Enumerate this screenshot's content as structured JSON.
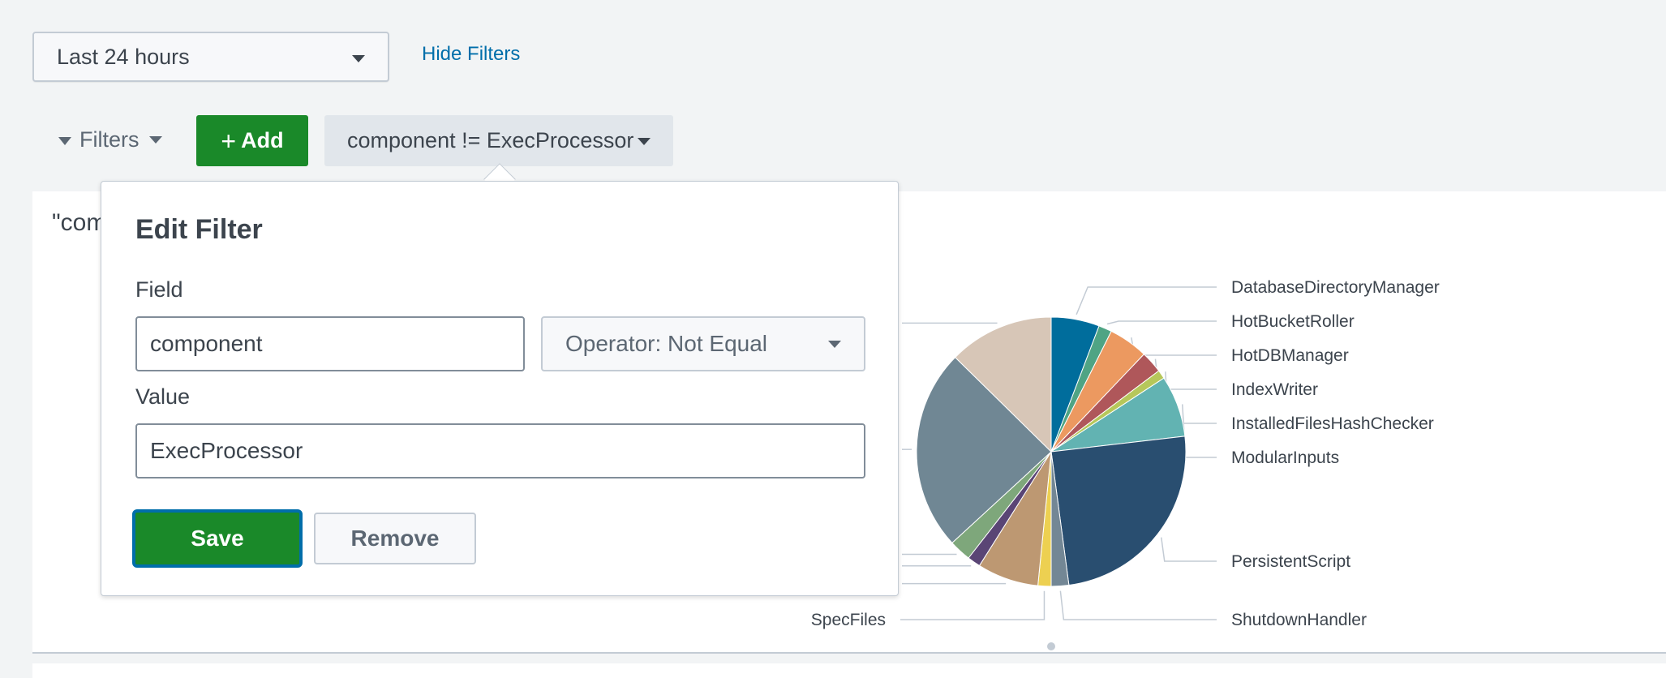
{
  "time_range": {
    "value": "Last 24 hours"
  },
  "hide_filters_label": "Hide Filters",
  "filters_bar": {
    "filters_label": "Filters",
    "add_label": "Add",
    "chip_label": "component != ExecProcessor"
  },
  "panel": {
    "title_partial": "\"com"
  },
  "edit_filter": {
    "title": "Edit Filter",
    "field_label": "Field",
    "field_value": "component",
    "operator_label": "Operator: Not Equal",
    "value_label": "Value",
    "value_value": "ExecProcessor",
    "save_label": "Save",
    "remove_label": "Remove"
  },
  "chart_data": {
    "type": "pie",
    "slices": [
      {
        "label": "DatabaseDirectoryManager",
        "value": 5.5,
        "color": "#006d9c"
      },
      {
        "label": "HotBucketRoller",
        "value": 1.5,
        "color": "#4fa484"
      },
      {
        "label": "HotDBManager",
        "value": 4.5,
        "color": "#ec9960"
      },
      {
        "label": "IndexWriter",
        "value": 2.5,
        "color": "#af575a"
      },
      {
        "label": "InstalledFilesHashChecker",
        "value": 1.0,
        "color": "#b6c75a"
      },
      {
        "label": "ModularInputs",
        "value": 7.0,
        "color": "#62b3b2"
      },
      {
        "label": "PersistentScript",
        "value": 23.5,
        "color": "#294e70"
      },
      {
        "label": "ShutdownHandler",
        "value": 2.0,
        "color": "#738795"
      },
      {
        "label": "SpecFiles",
        "value": 1.5,
        "color": "#edd051"
      },
      {
        "label": "",
        "value": 7.0,
        "color": "#bd9872"
      },
      {
        "label": "",
        "value": 1.5,
        "color": "#5a4575"
      },
      {
        "label": "",
        "value": 2.5,
        "color": "#7ea77b"
      },
      {
        "label": "",
        "value": 23.0,
        "color": "#708794"
      },
      {
        "label": "",
        "value": 12.0,
        "color": "#d7c6b7"
      }
    ]
  }
}
